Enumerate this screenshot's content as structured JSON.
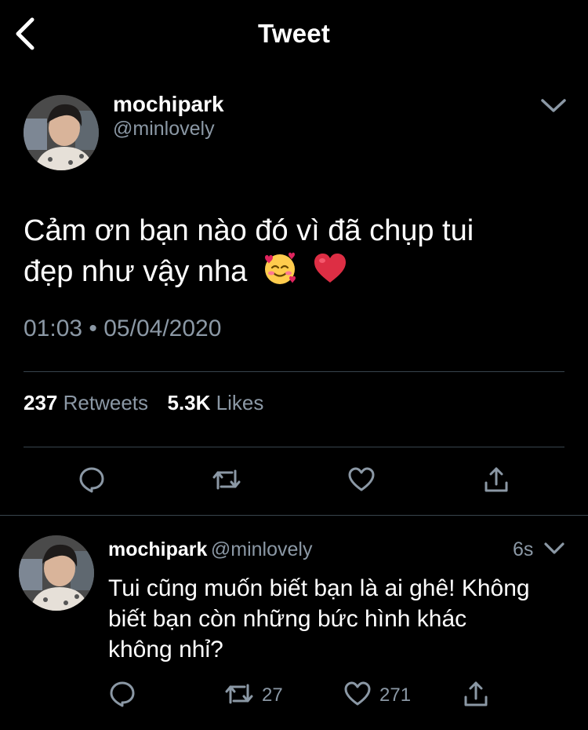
{
  "header": {
    "title": "Tweet",
    "back_icon": "chevron-left-icon"
  },
  "main_tweet": {
    "author": {
      "display_name": "mochipark",
      "handle": "@minlovely"
    },
    "text_line1": "Cảm ơn bạn nào đó vì đã chụp tui",
    "text_line2": "đẹp như vậy nha",
    "emojis": [
      "smiling-face-with-hearts",
      "red-heart"
    ],
    "timestamp": "01:03 • 05/04/2020",
    "retweets_count": "237",
    "retweets_label": "Retweets",
    "likes_count": "5.3K",
    "likes_label": "Likes",
    "actions": [
      "reply-icon",
      "retweet-icon",
      "like-icon",
      "share-icon"
    ]
  },
  "reply": {
    "author": {
      "display_name": "mochipark",
      "handle": "@minlovely"
    },
    "time": "6s",
    "text_line1": "Tui cũng muốn biết bạn là ai ghê! Không",
    "text_line2": "biết bạn còn những bức hình khác",
    "text_line3": "không nhỉ?",
    "retweets": "27",
    "likes": "271"
  },
  "colors": {
    "background": "#000000",
    "text": "#ffffff",
    "secondary": "#8b98a5",
    "divider": "#38444d",
    "heart_red": "#e0245e"
  }
}
